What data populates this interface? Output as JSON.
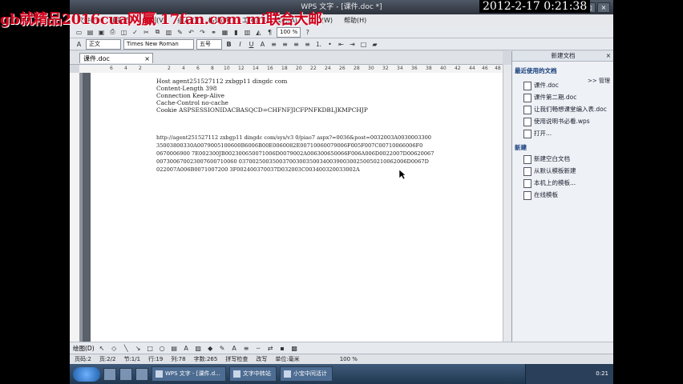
{
  "overlay": {
    "watermark": "gb就精品2016cua网赢 17fan.com mi联合大邮",
    "clock": "2012-2-17 0:21:38"
  },
  "window": {
    "title": "WPS 文字 - [课件.doc *]"
  },
  "menubar": {
    "items": [
      "文件(F)",
      "编辑(E)",
      "视图(V)",
      "插入(I)",
      "格式(O)",
      "工具(T)",
      "表格(A)",
      "窗口(W)",
      "帮助(H)"
    ]
  },
  "toolbar": {
    "style": "正文",
    "font": "Times New Roman",
    "size": "五号",
    "zoom": "100 %"
  },
  "tabs": {
    "doc_tab": "课件.doc"
  },
  "ruler": {
    "marks": [
      "6",
      "4",
      "2",
      "2",
      "4",
      "6",
      "8",
      "10",
      "12",
      "14",
      "16",
      "18",
      "20",
      "22",
      "24",
      "26",
      "28",
      "30",
      "32",
      "34",
      "36",
      "38",
      "40",
      "42",
      "44",
      "46",
      "48"
    ]
  },
  "document": {
    "header_lines": [
      "Host agent251527112 zxbgp11 dingdc com",
      "Content-Length 398",
      "Connection Keep-Alive",
      "Cache-Control no-cache",
      "Cookie ASPSESSIONIDACBASQCD=CHFNFJICFPNFKDBLJKMPCHJP"
    ],
    "url_lines": [
      "http://agent251527112 zxbgp11 dingdc com/sys/v3 0/piao7 aspx?=0036&post=0032003A0030003300",
      "35003800330A0079005100600B6006B00E0060082E00710060079006F005F007C00710066006F0",
      "0670006900 7E002300JB002300650071006D0079002A006300650066F006A006D0022007D00620067",
      "007300670023007600710060 03700250035003700300350034003900300250050210062006D0067D",
      "022007A006B0071007200 3F002400370037D032003C003400320033002A"
    ]
  },
  "taskpane": {
    "title": "新建文档",
    "recent_heading": "最近使用的文档",
    "manage": ">> 管理",
    "recent": [
      "课件.doc",
      "课件第二期.doc",
      "让我们畅想课堂编入表.doc",
      "使用说明书必看.wps",
      "打开..."
    ],
    "new_heading": "新建",
    "new_items": [
      "新建空白文档",
      "从默认模板新建",
      "本机上的模板...",
      "在线模板"
    ]
  },
  "drawbar": {
    "label": "绘图(D)"
  },
  "statusbar": {
    "page": "页码:2",
    "pages": "页:2/2",
    "section": "节:1/1",
    "row": "行:19",
    "col": "列:78",
    "chars": "字数:265",
    "spell": "拼写检查",
    "mode": "改写",
    "unit": "单位:毫米",
    "zoom": "100 %"
  },
  "taskbar": {
    "apps": [
      "WPS 文字 - [课件.d...",
      "文字中转站",
      "小宝中间活计"
    ],
    "time": "0:21"
  }
}
